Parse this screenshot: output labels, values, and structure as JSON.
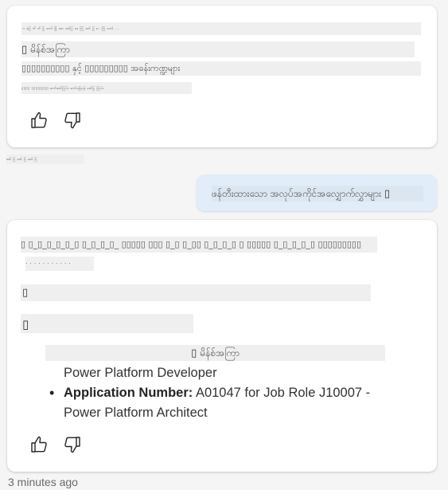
{
  "assistant_msg_1": {
    "garbled_line_1": "ာ ဖြေ ကိ ကိ ပြ ကော် ဖြုံ ဖော ဖော်ပြ ဖေ ကြ ဖော် ပြ ေ ကြ ကော် ...",
    "mission_label": "မိန်စ်အကြာ",
    "garbled_line_3": "▯▯▯▯▯▯▯▯▯▯ နှင့် ▯▯▯▯▯▯▯▯▯ အခန်းကဏ္ဍများ",
    "garbled_line_4": "▯▯▯▯ ▯▯▯▯▯▯▯▯ ကော်ဖော်ကြမ်း ကော်ဖြေရန် ဖော်ပြ ကြမ်း",
    "like_icon": "thumb-up",
    "dislike_icon": "thumb-down"
  },
  "system_note": "ဖော် ပြ ဖော် ပြ ဖော် ပြ",
  "user_msg": {
    "text": "ဖန်တီးထားသော အလုပ်အကိုင်အလျှောက်လွှာများ",
    "end_glyph": "▯"
  },
  "assistant_msg_2": {
    "garbled_line_1": "▯ ▯_▯_▯_▯_▯_▯ ▯_▯_▯_▯_ ▯▯▯▯▯ ▯▯▯ ▯_▯ ▯_▯▯ ▯_▯_▯_▯ ▯ ▯▯▯▯▯ ▯_▯_▯_▯_▯ ▯▯▯▯▯▯▯▯▯",
    "garbled_line_2": "· · · · · · · · · · ·",
    "glyph_row_1": "▯",
    "glyph_row_2": "▯",
    "mission_label": "မိန်စ်အကြာ",
    "list_item_1_continuation": "Power Platform Developer",
    "list_item_2_label": "Application Number:",
    "list_item_2_value": " A01047 for Job Role J10007 - Power Platform Architect",
    "like_icon": "thumb-up",
    "dislike_icon": "thumb-down"
  },
  "timestamp": "3 minutes ago",
  "colors": {
    "background": "#f5f5f5",
    "card": "#ffffff",
    "user_bubble": "#e1edf9",
    "garble_bg": "#efefef"
  }
}
